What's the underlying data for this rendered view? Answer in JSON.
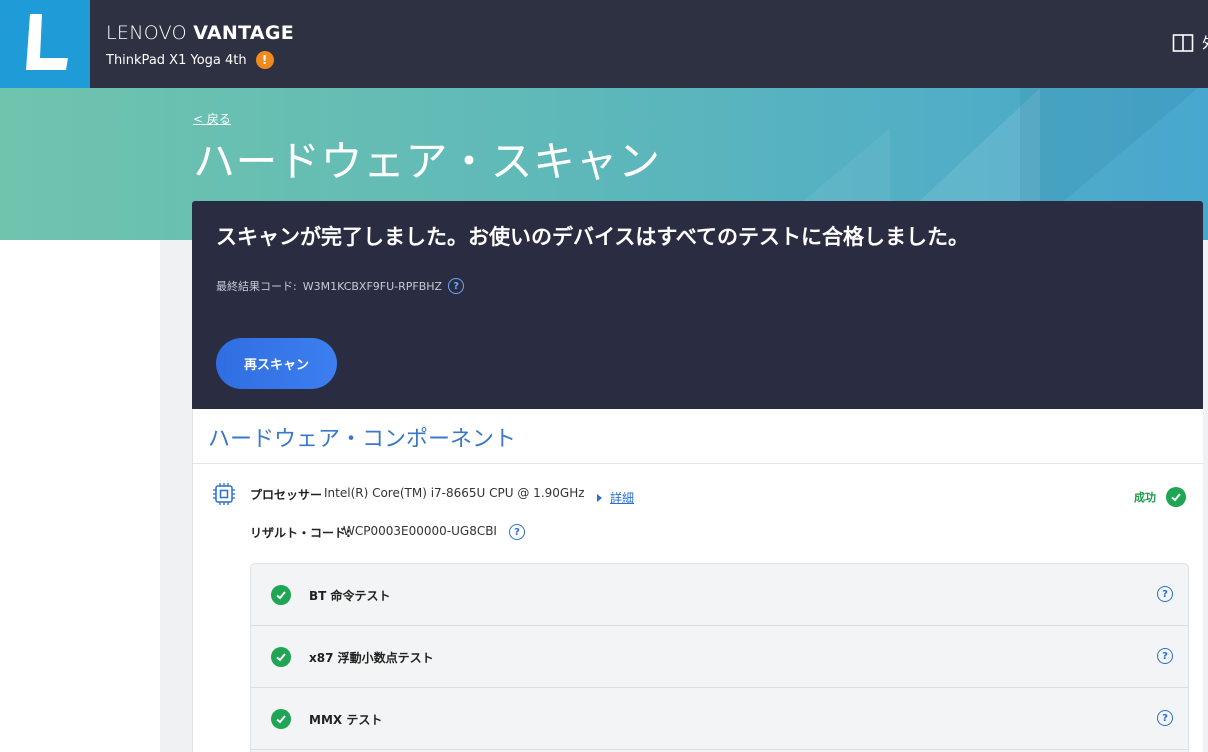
{
  "header": {
    "brand_thin": "LENOVO ",
    "brand_bold": "VANTAGE",
    "device": "ThinkPad X1 Yoga 4th",
    "warning_symbol": "!",
    "right_text": "外"
  },
  "hero": {
    "back": "< 戻る",
    "title": "ハードウェア・スキャン"
  },
  "result": {
    "message": "スキャンが完了しました。お使いのデバイスはすべてのテストに合格しました。",
    "code_label": "最終結果コード:",
    "code_value": "W3M1KCBXF9FU-RPFBHZ",
    "rescan_label": "再スキャン"
  },
  "components": {
    "title": "ハードウェア・コンポーネント",
    "processor": {
      "label": "プロセッサー",
      "value": "Intel(R) Core(TM) i7-8665U CPU @ 1.90GHz",
      "detail_link": "詳細",
      "status": "成功",
      "result_code_label": "リザルト・コード:",
      "result_code_value": "WCP0003E00000-UG8CBI"
    },
    "tests": [
      {
        "name": "BT 命令テスト"
      },
      {
        "name": "x87 浮動小数点テスト"
      },
      {
        "name": "MMX テスト"
      }
    ]
  },
  "icons": {
    "help_symbol": "?",
    "success_color": "#1fa553",
    "accent_color": "#2a6fd0",
    "warning_color": "#f08a1c"
  }
}
